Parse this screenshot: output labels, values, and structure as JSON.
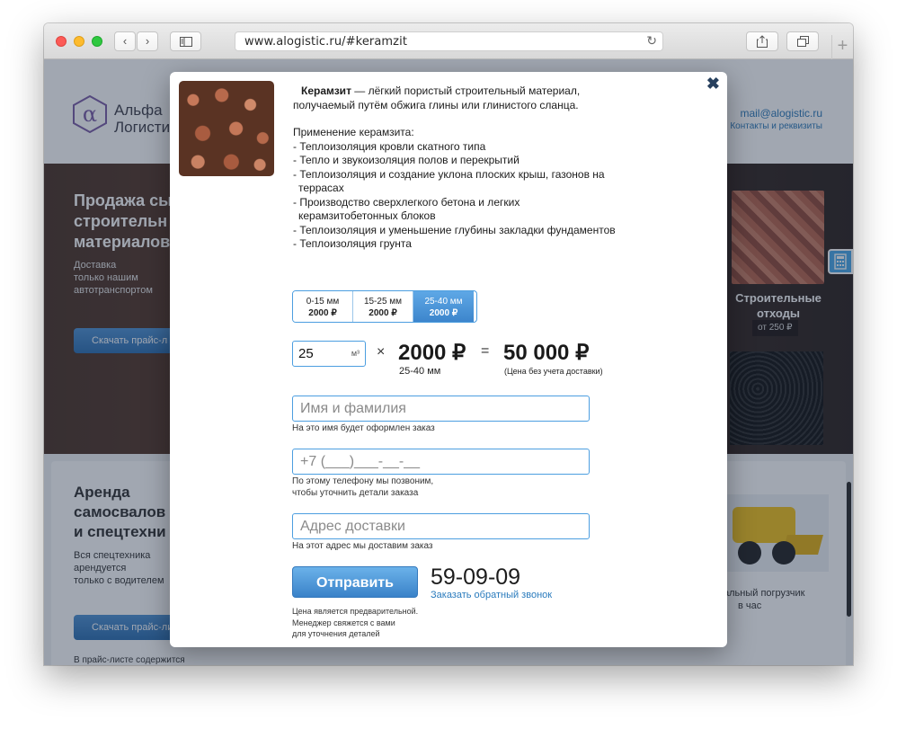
{
  "browser": {
    "url": "www.alogistic.ru/#keramzit",
    "back_icon": "‹",
    "forward_icon": "›",
    "reload_icon": "↻",
    "new_tab_icon": "+"
  },
  "site": {
    "logo": {
      "line1": "Альфа",
      "line2": "Логисти"
    },
    "email": "mail@alogistic.ru",
    "contacts": "Контакты и реквизиты",
    "hero": {
      "title_1": "Продажа сы",
      "title_2": "строительн",
      "title_3": "материалов",
      "sub_1": "Доставка",
      "sub_2": "только нашим",
      "sub_3": "автотранспортом",
      "button": "Скачать прайс-л"
    },
    "waste": {
      "title_1": "Строительные",
      "title_2": "отходы",
      "price": "от 250 ₽"
    },
    "rent": {
      "title_1": "Аренда",
      "title_2": "самосвалов",
      "title_3": "и спецтехни",
      "sub_1": "Вся спецтехника",
      "sub_2": "арендуется",
      "sub_3": "только с водителем",
      "button": "Скачать прайс-ли",
      "note": "В прайс-листе содержится",
      "loader_caption_1": "альный погрузчик",
      "loader_caption_2": "в час"
    }
  },
  "modal": {
    "close_icon": "✖",
    "product_name": "Керамзит",
    "lead": " — лёгкий пористый строительный материал,",
    "lead_2": "получаемый путём обжига глины или глинистого сланца.",
    "applications_title": "Применение керамзита:",
    "applications": [
      "- Теплоизоляция кровли скатного типа",
      "- Тепло и звукоизоляция полов и перекрытий",
      "- Теплоизоляция и создание уклона плоских крыш, газонов на террасах",
      "- Производство сверхлегкого бетона и легких керамзитобетонных блоков",
      "- Теплоизоляция и уменьшение глубины закладки фундаментов",
      "- Теплоизоляция грунта"
    ],
    "fractions": [
      {
        "size": "0-15 мм",
        "price": "2000 ₽"
      },
      {
        "size": "15-25 мм",
        "price": "2000 ₽"
      },
      {
        "size": "25-40 мм",
        "price": "2000 ₽"
      }
    ],
    "selected_fraction": 2,
    "quantity": "25",
    "unit": "м³",
    "times": "×",
    "price": "2000 ₽",
    "price_sub": "25-40 мм",
    "equals": "=",
    "total": "50 000 ₽",
    "total_sub": "(Цена без учета доставки)",
    "name_placeholder": "Имя и фамилия",
    "name_note": "На это имя будет оформлен заказ",
    "phone_placeholder": "+7 (___)___-__-__",
    "phone_note_1": "По этому телефону мы позвоним,",
    "phone_note_2": "чтобы уточнить детали заказа",
    "address_placeholder": "Адрес доставки",
    "address_note": "На этот адрес мы доставим заказ",
    "submit": "Отправить",
    "submit_note_1": "Цена является предварительной.",
    "submit_note_2": "Менеджер свяжется с вами",
    "submit_note_3": "для уточнения деталей",
    "phone_number": "59-09-09",
    "callback": "Заказать обратный звонок"
  }
}
